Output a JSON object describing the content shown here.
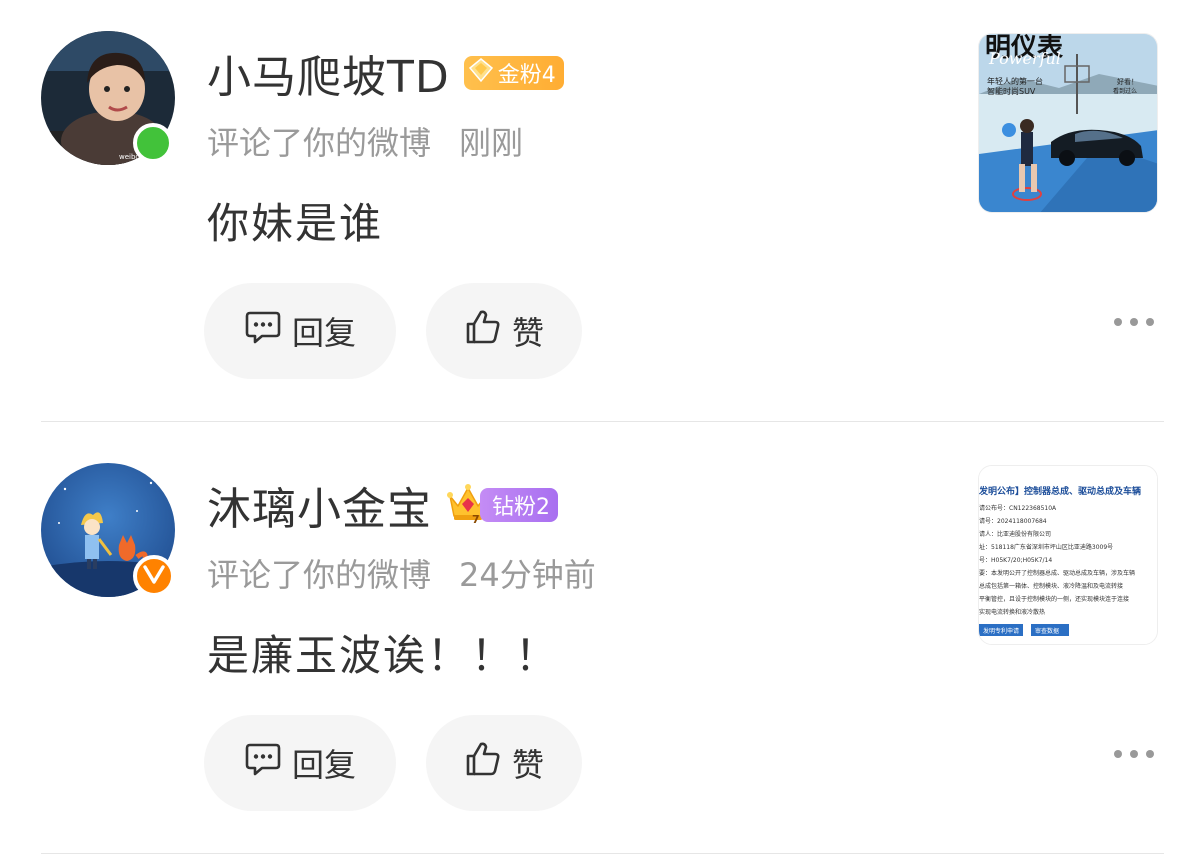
{
  "comments": [
    {
      "username": "小马爬坡TD",
      "fan_badge": {
        "label": "金粉4",
        "level_color": "#ffb13b"
      },
      "action": "评论了你的微博",
      "time": "刚刚",
      "text": "你妹是谁",
      "status": "online",
      "reply_label": "回复",
      "like_label": "赞",
      "thumbnail": {
        "kind": "car-ad-image",
        "title_text": "明仪表",
        "script_text": "Powerful",
        "line1": "年轻人的第一台",
        "line2": "智能时尚SUV",
        "side_text1": "好看！",
        "side_text2": "看到过么"
      }
    },
    {
      "username": "沐璃小金宝",
      "fan_badge": {
        "label": "钻粉2",
        "level_color": "#b27af2",
        "crown_level": "7"
      },
      "action": "评论了你的微博",
      "time": "24分钟前",
      "text": "是廉玉波诶！！！",
      "status": "verified",
      "verified_mark": "V",
      "reply_label": "回复",
      "like_label": "赞",
      "thumbnail": {
        "kind": "document-screenshot",
        "title": "发明公布】控制器总成、驱动总成及车辆",
        "lines": [
          "请公布号：CN122368510A",
          "请号：2024118007684",
          "请人：比亚迪股份有限公司",
          "址：518118广东省深圳市坪山区比亚迪路3009号",
          "号：H05K7/20;H05K7/14",
          "要：本发明公开了控制器总成、驱动总成及车辆，涉及车辆",
          "总成包括第一箱体、控制模块、液冷降温和及电流转接",
          "平衡管控，且设于控制模块的一侧，还实现模块连于连接",
          "实现电流转换和液冷散热"
        ],
        "btn1": "发明专利申请",
        "btn2": "审查数据"
      }
    }
  ]
}
